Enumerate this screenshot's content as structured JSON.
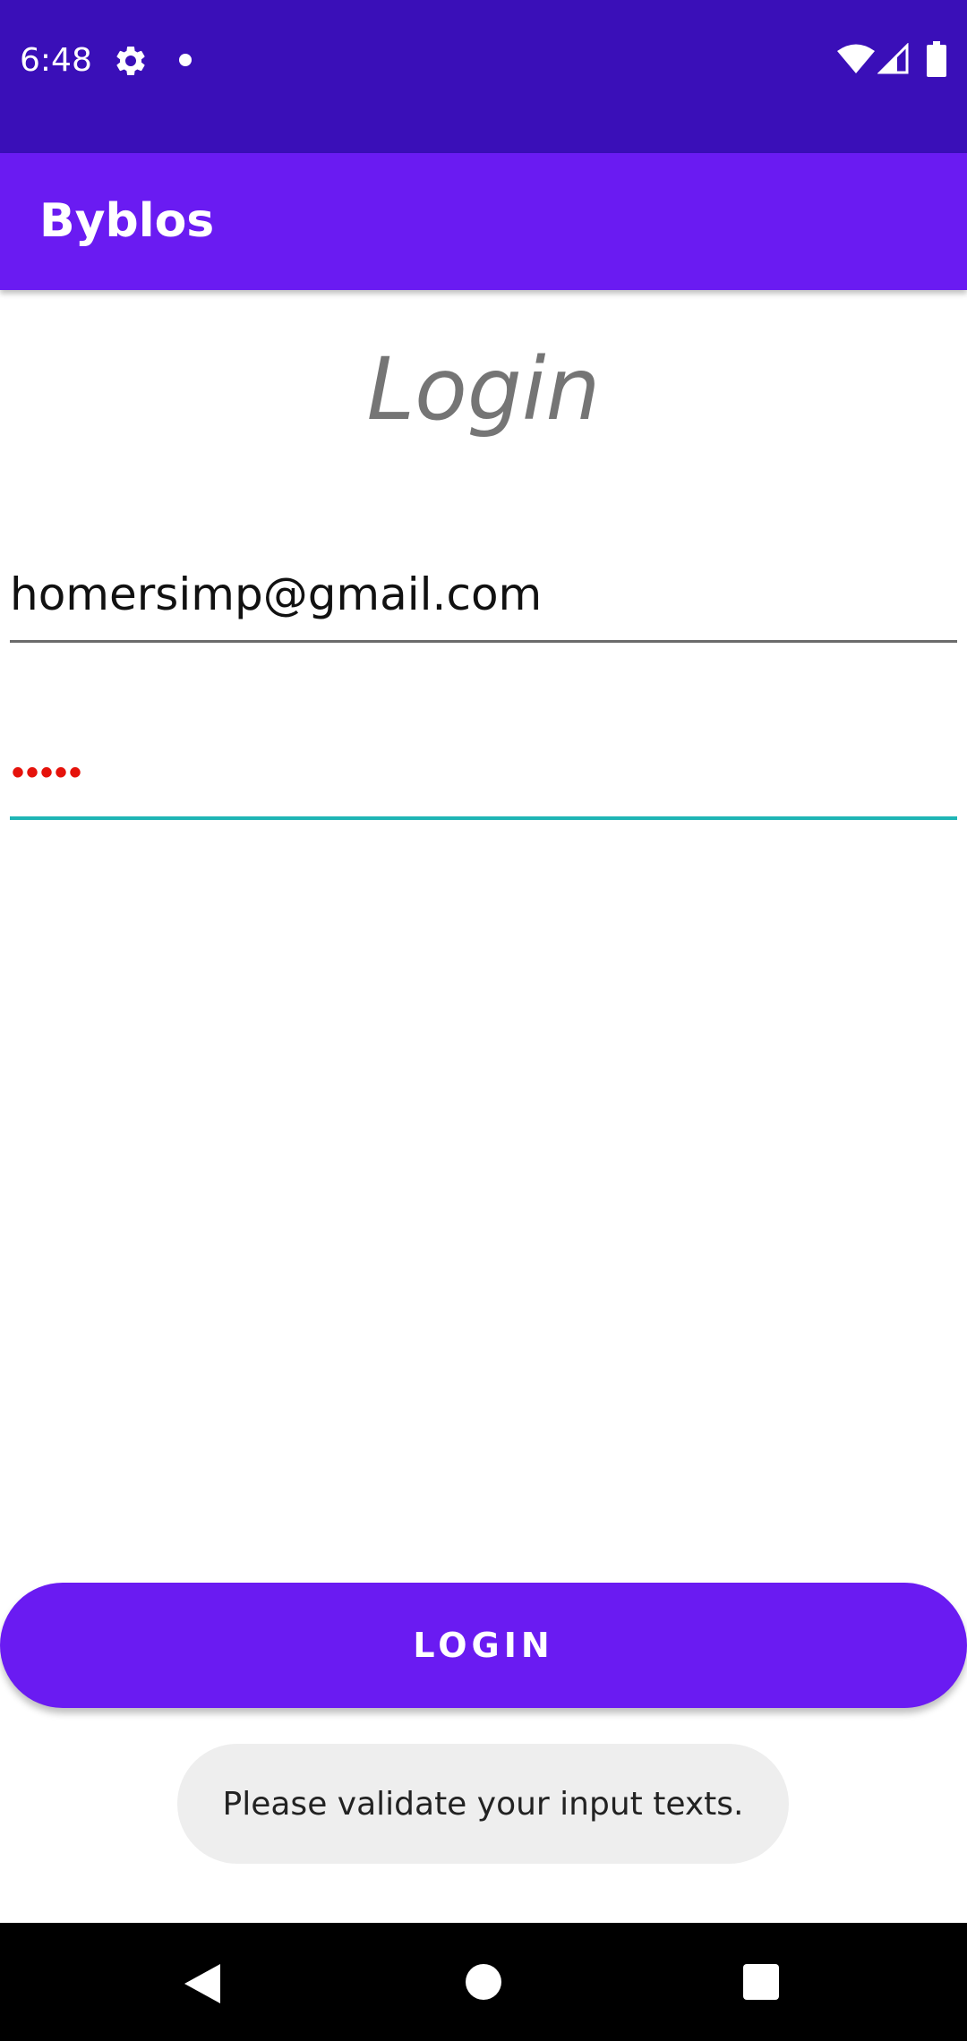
{
  "status_bar": {
    "time": "6:48",
    "icons": [
      "gear-icon",
      "notification-dot-icon",
      "wifi-icon",
      "signal-icon",
      "battery-icon"
    ]
  },
  "app_bar": {
    "title": "Byblos",
    "color": "#6a1bf2"
  },
  "login": {
    "heading": "Login",
    "email_value": "homersimp@gmail.com",
    "password_mask": "•••••",
    "button_label": "LOGIN"
  },
  "toast": {
    "message": "Please validate your input texts."
  },
  "nav_bar": {
    "icons": [
      "back-icon",
      "home-icon",
      "recents-icon"
    ]
  },
  "colors": {
    "status_bar": "#3a0fb8",
    "accent": "#6a1bf2",
    "password_text": "#e5120b",
    "focused_underline": "#1fb5b5"
  }
}
